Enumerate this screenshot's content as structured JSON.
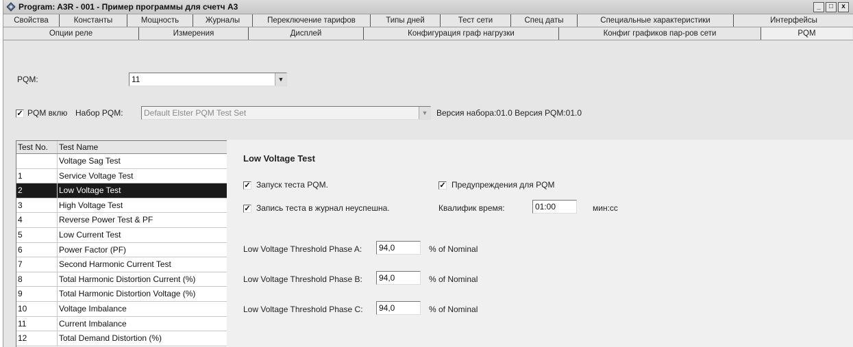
{
  "window": {
    "title": "Program: A3R - 001 - Пример программы для счетч A3",
    "minimize": "_",
    "maximize": "□",
    "close": "x"
  },
  "tabs_row1": [
    "Свойства",
    "Константы",
    "Мощность",
    "Журналы",
    "Переключение тарифов",
    "Типы дней",
    "Тест сети",
    "Спец даты",
    "Специальные характеристики",
    "Интерфейсы"
  ],
  "tabs_row2": [
    "Опции реле",
    "Измерения",
    "Дисплей",
    "Конфигурация граф нагрузки",
    "Конфиг графиков пар-ров сети",
    "PQM"
  ],
  "active_tab": "PQM",
  "pqm": {
    "label": "PQM:",
    "value": "11",
    "enabled_label": "PQM вклю",
    "enabled_checked": true,
    "set_label": "Набор PQM:",
    "set_value": "Default Elster PQM Test Set",
    "versions": "Версия набора:01.0 Версия PQM:01.0"
  },
  "table": {
    "headers": [
      "Test No.",
      "Test Name"
    ],
    "rows": [
      {
        "no": "",
        "name": "Voltage Sag Test"
      },
      {
        "no": "1",
        "name": "Service Voltage Test"
      },
      {
        "no": "2",
        "name": "Low Voltage Test"
      },
      {
        "no": "3",
        "name": "High Voltage Test"
      },
      {
        "no": "4",
        "name": "Reverse Power Test & PF"
      },
      {
        "no": "5",
        "name": "Low Current Test"
      },
      {
        "no": "6",
        "name": "Power Factor (PF)"
      },
      {
        "no": "7",
        "name": "Second Harmonic Current Test"
      },
      {
        "no": "8",
        "name": "Total Harmonic Distortion Current (%)"
      },
      {
        "no": "9",
        "name": "Total Harmonic Distortion Voltage (%)"
      },
      {
        "no": "10",
        "name": "Voltage Imbalance"
      },
      {
        "no": "11",
        "name": "Current Imbalance"
      },
      {
        "no": "12",
        "name": "Total Demand Distortion (%)"
      }
    ],
    "selected_index": 2
  },
  "detail": {
    "title": "Low Voltage Test",
    "run_label": "Запуск теста PQM.",
    "run_checked": true,
    "warn_label": "Предупреждения для PQM",
    "warn_checked": true,
    "log_label": "Запись теста в журнал неуспешна.",
    "log_checked": true,
    "qual_label": "Квалифик время:",
    "qual_value": "01:00",
    "qual_unit": "мин:сс",
    "thresholds": [
      {
        "label": "Low Voltage Threshold Phase A:",
        "value": "94,0",
        "unit": "% of Nominal"
      },
      {
        "label": "Low Voltage Threshold Phase B:",
        "value": "94,0",
        "unit": "% of Nominal"
      },
      {
        "label": "Low Voltage Threshold Phase C:",
        "value": "94,0",
        "unit": "% of Nominal"
      }
    ]
  },
  "glyphs": {
    "check": "✓",
    "dropdown": "▼"
  }
}
